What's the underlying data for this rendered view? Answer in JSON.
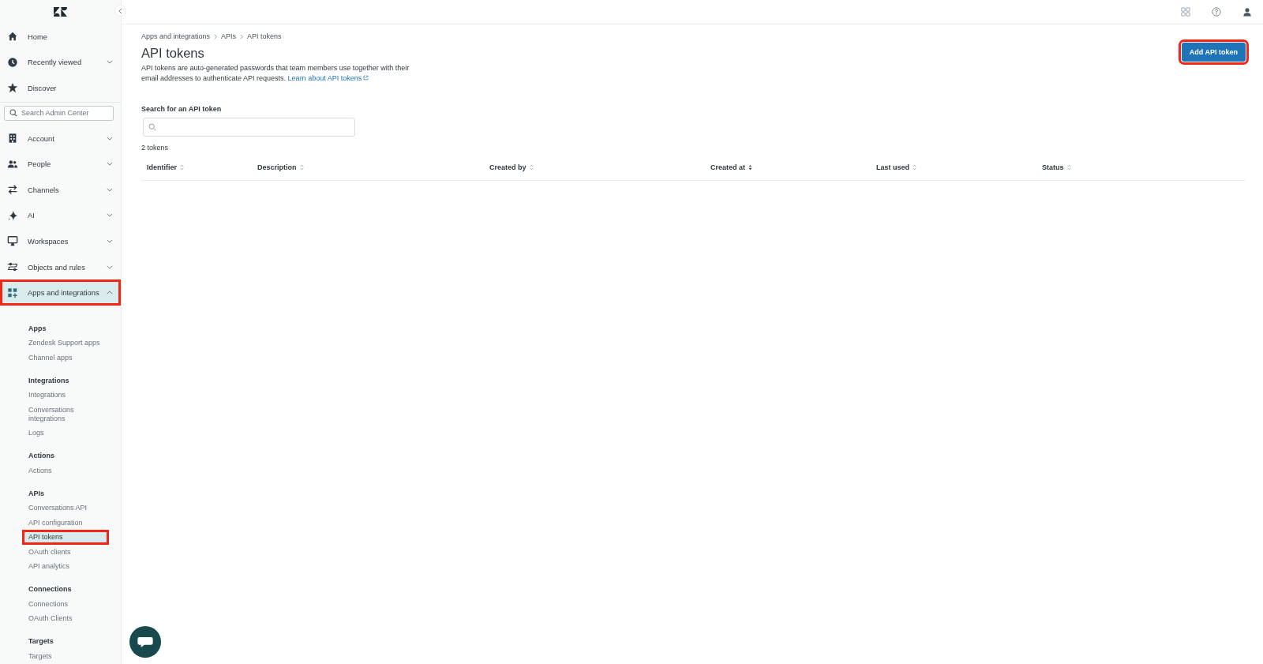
{
  "nav": [
    {
      "label": "Home",
      "kind": "link",
      "selected": false,
      "highlighted": false
    },
    {
      "label": "Recently viewed",
      "kind": "menu",
      "expanded": false,
      "selected": false,
      "highlighted": false
    },
    {
      "label": "Discover",
      "kind": "link",
      "selected": false,
      "highlighted": false
    }
  ],
  "sidebar_search": {
    "placeholder": "Search Admin Center"
  },
  "sections": [
    {
      "label": "Account",
      "kind": "menu",
      "expanded": false,
      "selected": false,
      "highlighted": false
    },
    {
      "label": "People",
      "kind": "menu",
      "expanded": false,
      "selected": false,
      "highlighted": false
    },
    {
      "label": "Channels",
      "kind": "menu",
      "expanded": false,
      "selected": false,
      "highlighted": false
    },
    {
      "label": "AI",
      "kind": "menu",
      "expanded": false,
      "selected": false,
      "highlighted": false
    },
    {
      "label": "Workspaces",
      "kind": "menu",
      "expanded": false,
      "selected": false,
      "highlighted": false
    },
    {
      "label": "Objects and rules",
      "kind": "menu",
      "expanded": false,
      "selected": false,
      "highlighted": false
    },
    {
      "label": "Apps and integrations",
      "kind": "menu",
      "expanded": true,
      "selected": true,
      "highlighted": true
    }
  ],
  "submenu": [
    {
      "heading": "Apps",
      "items": [
        {
          "label": "Zendesk Support apps",
          "selected": false,
          "highlighted": false
        },
        {
          "label": "Channel apps",
          "selected": false,
          "highlighted": false
        }
      ]
    },
    {
      "heading": "Integrations",
      "items": [
        {
          "label": "Integrations",
          "selected": false,
          "highlighted": false
        },
        {
          "label": "Conversations integrations",
          "selected": false,
          "highlighted": false
        },
        {
          "label": "Logs",
          "selected": false,
          "highlighted": false
        }
      ]
    },
    {
      "heading": "Actions",
      "items": [
        {
          "label": "Actions",
          "selected": false,
          "highlighted": false
        }
      ]
    },
    {
      "heading": "APIs",
      "items": [
        {
          "label": "Conversations API",
          "selected": false,
          "highlighted": false
        },
        {
          "label": "API configuration",
          "selected": false,
          "highlighted": false
        },
        {
          "label": "API tokens",
          "selected": true,
          "highlighted": true
        },
        {
          "label": "OAuth clients",
          "selected": false,
          "highlighted": false
        },
        {
          "label": "API analytics",
          "selected": false,
          "highlighted": false
        }
      ]
    },
    {
      "heading": "Connections",
      "items": [
        {
          "label": "Connections",
          "selected": false,
          "highlighted": false
        },
        {
          "label": "OAuth Clients",
          "selected": false,
          "highlighted": false
        }
      ]
    },
    {
      "heading": "Targets",
      "items": [
        {
          "label": "Targets",
          "selected": false,
          "highlighted": false
        }
      ]
    }
  ],
  "breadcrumb": [
    "Apps and integrations",
    "APIs",
    "API tokens"
  ],
  "page": {
    "title": "API tokens",
    "description": "API tokens are auto-generated passwords that team members use together with their email addresses to authenticate API requests.",
    "link": "Learn about API tokens"
  },
  "add_button": {
    "label": "Add API token",
    "highlighted": true
  },
  "token_search": {
    "label": "Search for an API token"
  },
  "count": "2 tokens",
  "table": {
    "columns": [
      {
        "label": "Identifier",
        "sorted": false
      },
      {
        "label": "Description",
        "sorted": false
      },
      {
        "label": "Created by",
        "sorted": false
      },
      {
        "label": "Created at",
        "sorted": true
      },
      {
        "label": "Last used",
        "sorted": false
      },
      {
        "label": "Status",
        "sorted": false
      }
    ]
  }
}
